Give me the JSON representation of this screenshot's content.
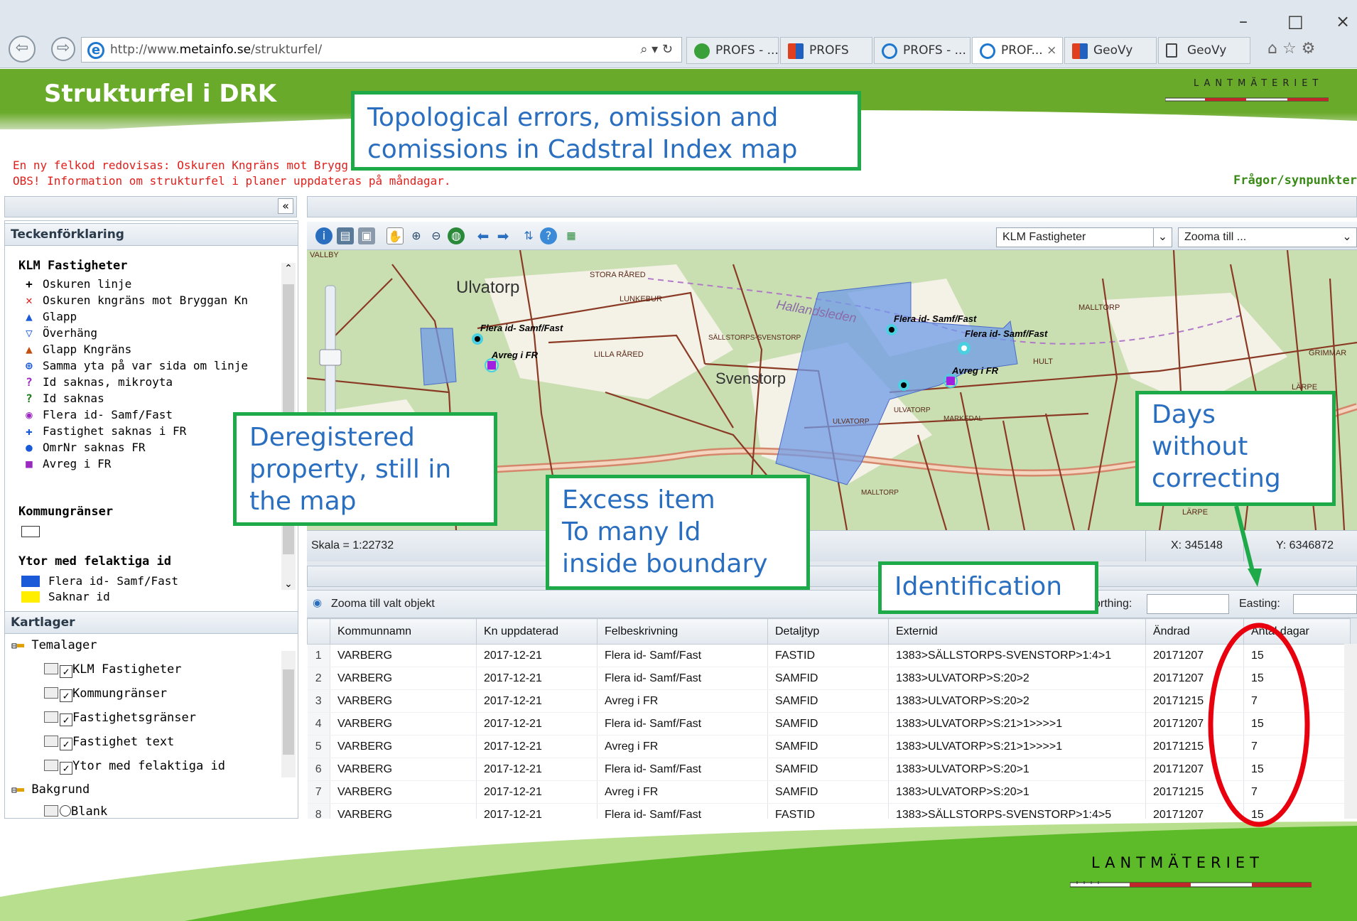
{
  "browser": {
    "url_prefix": "http://www.",
    "url_domain": "metainfo.se",
    "url_path": "/strukturfel/",
    "search_icon": "magnifier-dropdown",
    "tabs": [
      {
        "label": "PROFS - ...",
        "icon": "profs-icon"
      },
      {
        "label": "PROFS",
        "icon": "chart-icon"
      },
      {
        "label": "PROFS - ...",
        "icon": "ie-icon"
      },
      {
        "label": "PROF...",
        "icon": "ie-icon",
        "active": true
      },
      {
        "label": "GeoVy",
        "icon": "chart-icon"
      },
      {
        "label": "GeoVy",
        "icon": "page-icon"
      }
    ],
    "close_tab": "×",
    "win_min": "–",
    "win_max": "□",
    "win_close": "×"
  },
  "app": {
    "title": "Strukturfel i DRK",
    "brand": "LANTMÄTERIET",
    "notice_line1": "En ny felkod redovisas: Oskuren Kngräns mot Brygg",
    "notice_line2": "OBS! Information om strukturfel i planer uppdateras på måndagar.",
    "feedback": "Frågor/synpunkter"
  },
  "legend": {
    "header": "Teckenförklaring",
    "section1_title": "KLM Fastigheter",
    "items": [
      {
        "symbol": "+",
        "label": "Oskuren linje",
        "color": "#000000"
      },
      {
        "symbol": "✕",
        "label": "Oskuren kngräns mot Bryggan Kn",
        "color": "#e02020"
      },
      {
        "symbol": "▲",
        "label": "Glapp",
        "color": "#1a5ad8"
      },
      {
        "symbol": "▽",
        "label": "Överhäng",
        "color": "#1a5ad8"
      },
      {
        "symbol": "▲",
        "label": "Glapp Kngräns",
        "color": "#c05010"
      },
      {
        "symbol": "⊕",
        "label": "Samma yta på var sida om linje",
        "color": "#1a5ad8"
      },
      {
        "symbol": "?",
        "label": "Id saknas, mikroyta",
        "color": "#9a2ac0"
      },
      {
        "symbol": "?",
        "label": "Id saknas",
        "color": "#1a7a1a"
      },
      {
        "symbol": "◉",
        "label": "Flera id- Samf/Fast",
        "color": "#9a2ac0"
      },
      {
        "symbol": "✚",
        "label": "Fastighet saknas i FR",
        "color": "#1a5ad8"
      },
      {
        "symbol": "●",
        "label": "OmrNr saknas FR",
        "color": "#1a5ad8"
      },
      {
        "symbol": "■",
        "label": "Avreg i FR",
        "color": "#9a2ac0"
      }
    ],
    "section2_title": "Kommungränser",
    "section3_title": "Ytor med felaktiga id",
    "fill_items": [
      {
        "label": "Flera id- Samf/Fast",
        "color": "#1a5ad8"
      },
      {
        "label": "Saknar id",
        "color": "#ffee00"
      }
    ]
  },
  "layers": {
    "header": "Kartlager",
    "groups": [
      {
        "label": "Temalager",
        "items": [
          "KLM Fastigheter",
          "Kommungränser",
          "Fastighetsgränser",
          "Fastighet text",
          "Ytor med felaktiga id"
        ]
      },
      {
        "label": "Bakgrund",
        "items": [
          "Blank"
        ]
      }
    ]
  },
  "map": {
    "layer_select": "KLM Fastigheter",
    "zoom_select": "Zooma till ...",
    "scale": "Skala = 1:22732",
    "x_coord": "X: 345148",
    "y_coord": "Y: 6346872",
    "labels": {
      "vallby": "VALLBY",
      "ulvatorp": "Ulvatorp",
      "stora_rared": "STORA RÅRED",
      "lunkeburr": "LUNKEBUR",
      "hallandsleden": "Hallandsleden",
      "sallstorps": "SÄLLSTORPS-SVENSTORP",
      "lilla_rared": "LILLA RÅRED",
      "svenstorp": "Svenstorp",
      "malltorp": "MALLTORP",
      "hult": "HULT",
      "grimmar": "GRIMMAR",
      "larpe": "LÄRPE",
      "larpe2": "LÄRPE",
      "ulvatorp_small": "ULVATORP",
      "ulvatorp_small2": "ULVATORP",
      "markedal": "MARKEDAL",
      "malltorp2": "MALLTORP",
      "flera1": "Flera id- Samf/Fast",
      "avreg1": "Avreg i FR",
      "flera2": "Flera id- Samf/Fast",
      "flera3": "Flera id- Samf/Fast",
      "avreg2": "Avreg i FR"
    }
  },
  "table": {
    "zoom_btn": "Zooma till valt objekt",
    "northing_label": "orthing:",
    "easting_label": "Easting:",
    "columns": [
      "",
      "Kommunnamn",
      "Kn uppdaterad",
      "Felbeskrivning",
      "Detaljtyp",
      "Externid",
      "Ändrad",
      "Antal dagar"
    ],
    "rows": [
      [
        "1",
        "VARBERG",
        "2017-12-21",
        "Flera id- Samf/Fast",
        "FASTID",
        "1383>SÄLLSTORPS-SVENSTORP>1:4>1",
        "20171207",
        "15"
      ],
      [
        "2",
        "VARBERG",
        "2017-12-21",
        "Flera id- Samf/Fast",
        "SAMFID",
        "1383>ULVATORP>S:20>2",
        "20171207",
        "15"
      ],
      [
        "3",
        "VARBERG",
        "2017-12-21",
        "Avreg i FR",
        "SAMFID",
        "1383>ULVATORP>S:20>2",
        "20171215",
        "7"
      ],
      [
        "4",
        "VARBERG",
        "2017-12-21",
        "Flera id- Samf/Fast",
        "SAMFID",
        "1383>ULVATORP>S:21>1>>>>1",
        "20171207",
        "15"
      ],
      [
        "5",
        "VARBERG",
        "2017-12-21",
        "Avreg i FR",
        "SAMFID",
        "1383>ULVATORP>S:21>1>>>>1",
        "20171215",
        "7"
      ],
      [
        "6",
        "VARBERG",
        "2017-12-21",
        "Flera id- Samf/Fast",
        "SAMFID",
        "1383>ULVATORP>S:20>1",
        "20171207",
        "15"
      ],
      [
        "7",
        "VARBERG",
        "2017-12-21",
        "Avreg i FR",
        "SAMFID",
        "1383>ULVATORP>S:20>1",
        "20171215",
        "7"
      ],
      [
        "8",
        "VARBERG",
        "2017-12-21",
        "Flera id- Samf/Fast",
        "FASTID",
        "1383>SÄLLSTORPS-SVENSTORP>1:4>5",
        "20171207",
        "15"
      ]
    ]
  },
  "callouts": {
    "topology_l1": "Topological errors, omission and",
    "topology_l2": "comissions in Cadstral Index map",
    "deregistered_l1": "Deregistered",
    "deregistered_l2": "property, still in",
    "deregistered_l3": "the map",
    "excess_l1": "Excess item",
    "excess_l2": "To many Id",
    "excess_l3": "inside boundary",
    "identification": "Identification",
    "days_l1": "Days",
    "days_l2": "without",
    "days_l3": "correcting"
  },
  "footer_brand": "LANTMÄTERIET",
  "colors": {
    "callout_border": "#1faa4a",
    "callout_text": "#2a6ec0",
    "ellipse": "#e8000f",
    "brand_green": "#6aaa2a",
    "bottom_green": "#5dbb2a",
    "bottom_light": "#b7df8d"
  }
}
